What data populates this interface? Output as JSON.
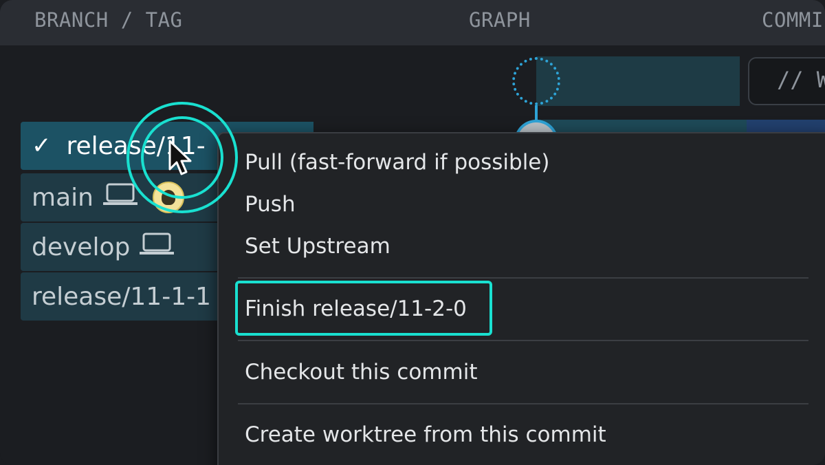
{
  "columns": {
    "branch_tag": "BRANCH / TAG",
    "graph": "GRAPH",
    "commit": "COMMI"
  },
  "wip_placeholder": "// W",
  "branches": [
    {
      "label": "release/11-",
      "active": true,
      "icon": "check-icon"
    },
    {
      "label": "main",
      "icons": [
        "laptop-icon",
        "avatar"
      ]
    },
    {
      "label": "develop",
      "icons": [
        "laptop-icon"
      ]
    },
    {
      "label": "release/11-1-1"
    }
  ],
  "context_menu": {
    "items": [
      {
        "label": "Pull (fast-forward if possible)"
      },
      {
        "label": "Push"
      },
      {
        "label": "Set Upstream"
      },
      {
        "label": "Finish release/11-2-0",
        "highlighted": true
      },
      {
        "label": "Checkout this commit"
      },
      {
        "label": "Create worktree from this commit"
      }
    ]
  },
  "colors": {
    "accent": "#19e0d0",
    "graph": "#2ea3d6",
    "active_branch": "#1c5264",
    "menu_bg": "#212326"
  }
}
